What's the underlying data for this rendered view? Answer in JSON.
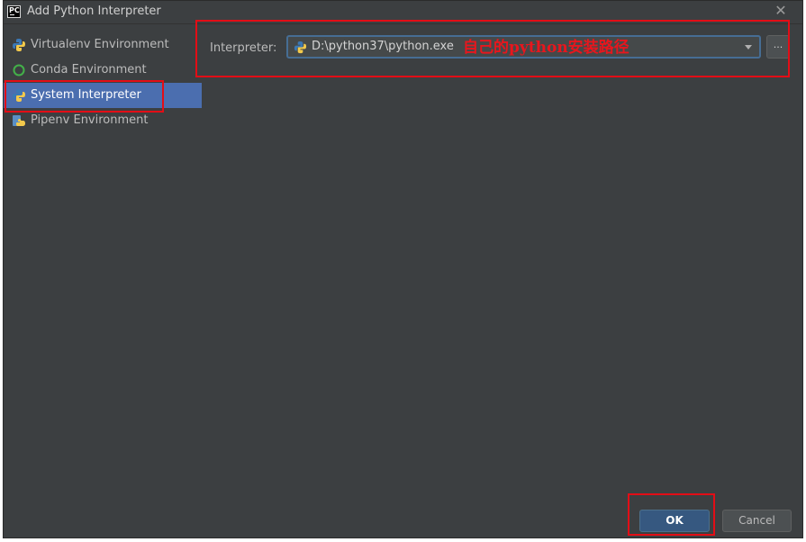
{
  "window": {
    "title": "Add Python Interpreter",
    "logo_text": "PC"
  },
  "sidebar": {
    "items": [
      {
        "label": "Virtualenv Environment",
        "icon": "virtualenv-icon"
      },
      {
        "label": "Conda Environment",
        "icon": "conda-icon"
      },
      {
        "label": "System Interpreter",
        "icon": "python-icon",
        "selected": true
      },
      {
        "label": "Pipenv Environment",
        "icon": "pipenv-icon"
      }
    ]
  },
  "interpreter": {
    "label": "Interpreter:",
    "value": "D:\\python37\\python.exe",
    "browse_label": "..."
  },
  "annotation": {
    "text": "自己的python安装路径",
    "color": "#e8161d"
  },
  "buttons": {
    "ok": "OK",
    "cancel": "Cancel"
  },
  "colors": {
    "background": "#3c3f41",
    "selection": "#4b6eaf",
    "ok_button": "#365880",
    "highlight_box": "#e30d16"
  }
}
